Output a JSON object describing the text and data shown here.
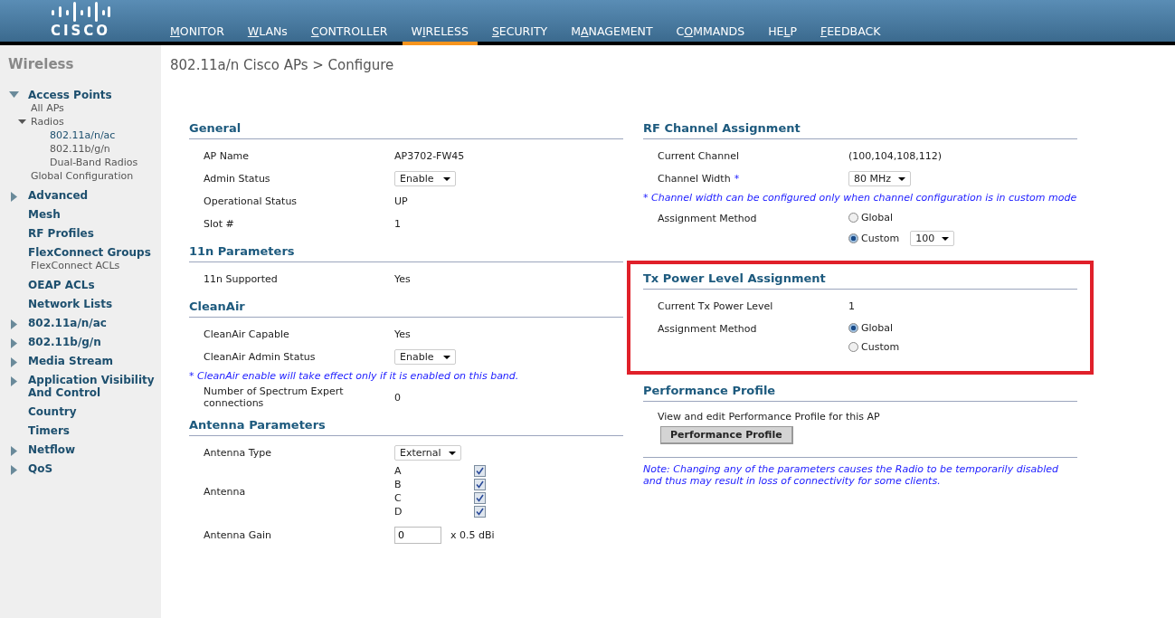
{
  "logo": {
    "text": "CISCO"
  },
  "nav": [
    {
      "key": "M",
      "after": "ONITOR",
      "selected": false
    },
    {
      "key": "W",
      "after": "LANs",
      "selected": false
    },
    {
      "key": "C",
      "after": "ONTROLLER",
      "selected": false
    },
    {
      "before": "W",
      "key": "I",
      "after": "RELESS",
      "selected": true
    },
    {
      "key": "S",
      "after": "ECURITY",
      "selected": false
    },
    {
      "before": "M",
      "key": "A",
      "after": "NAGEMENT",
      "selected": false
    },
    {
      "before": "C",
      "key": "O",
      "after": "MMANDS",
      "selected": false
    },
    {
      "before": "HE",
      "key": "L",
      "after": "P",
      "selected": false
    },
    {
      "key": "F",
      "after": "EEDBACK",
      "selected": false
    }
  ],
  "sidebar": {
    "title": "Wireless",
    "items": [
      {
        "label": "Access Points",
        "expanded": true,
        "children": [
          {
            "label": "All APs",
            "selected": false
          },
          {
            "label": "Radios",
            "expanded": true,
            "selected": false,
            "children": [
              {
                "label": "802.11a/n/ac",
                "selected": true
              },
              {
                "label": "802.11b/g/n",
                "selected": false
              },
              {
                "label": "Dual-Band Radios",
                "selected": false
              }
            ]
          },
          {
            "label": "Global Configuration",
            "selected": false
          }
        ]
      },
      {
        "label": "Advanced",
        "expanded": false
      },
      {
        "label": "Mesh"
      },
      {
        "label": "RF Profiles"
      },
      {
        "label": "FlexConnect Groups",
        "children": [
          {
            "label": "FlexConnect ACLs",
            "selected": false
          }
        ]
      },
      {
        "label": "OEAP ACLs"
      },
      {
        "label": "Network Lists"
      },
      {
        "label": "802.11a/n/ac",
        "expanded": false
      },
      {
        "label": "802.11b/g/n",
        "expanded": false
      },
      {
        "label": "Media Stream",
        "expanded": false
      },
      {
        "label": "Application Visibility And Control",
        "expanded": false
      },
      {
        "label": "Country"
      },
      {
        "label": "Timers"
      },
      {
        "label": "Netflow",
        "expanded": false
      },
      {
        "label": "QoS",
        "expanded": false
      }
    ]
  },
  "page_title": "802.11a/n Cisco APs > Configure",
  "columns": [
    [
      {
        "title": "General",
        "rows": [
          {
            "kind": "text",
            "label": "AP Name",
            "value": "AP3702-FW45"
          },
          {
            "kind": "select",
            "label": "Admin Status",
            "value": "Enable"
          },
          {
            "kind": "text",
            "label": "Operational Status",
            "value": "UP"
          },
          {
            "kind": "text",
            "label": "Slot #",
            "value": "1"
          }
        ]
      },
      {
        "title": "11n Parameters",
        "rows": [
          {
            "kind": "text",
            "label": "11n Supported",
            "value": "Yes"
          }
        ]
      },
      {
        "title": "CleanAir",
        "rows": [
          {
            "kind": "text",
            "label": "CleanAir Capable",
            "value": "Yes"
          },
          {
            "kind": "select",
            "label": "CleanAir Admin Status",
            "value": "Enable"
          },
          {
            "kind": "note",
            "text": "* CleanAir enable will take effect only if it is enabled on this band."
          },
          {
            "kind": "text",
            "label": "Number of Spectrum Expert connections",
            "value": "0"
          }
        ]
      },
      {
        "title": "Antenna Parameters",
        "rows": [
          {
            "kind": "select",
            "label": "Antenna Type",
            "value": "External"
          },
          {
            "kind": "checkboxes",
            "label": "Antenna",
            "options": [
              {
                "label": "A",
                "checked": true
              },
              {
                "label": "B",
                "checked": true
              },
              {
                "label": "C",
                "checked": true
              },
              {
                "label": "D",
                "checked": true
              }
            ]
          },
          {
            "kind": "input",
            "label": "Antenna Gain",
            "value": "0",
            "unit": "x 0.5 dBi"
          }
        ]
      }
    ],
    [
      {
        "title": "RF Channel Assignment",
        "rows": [
          {
            "kind": "text",
            "label": "Current Channel",
            "value": "(100,104,108,112)"
          },
          {
            "kind": "select",
            "label": "Channel Width",
            "marker": "*",
            "value": "80 MHz"
          },
          {
            "kind": "note",
            "text": "* Channel width can be configured only when channel configuration is in custom mode"
          },
          {
            "kind": "radio",
            "label": "Assignment Method",
            "options": [
              {
                "label": "Global",
                "selected": false
              },
              {
                "label": "Custom",
                "selected": true,
                "select": "100"
              }
            ]
          }
        ]
      },
      {
        "title": "Tx Power Level Assignment",
        "highlighted": true,
        "rows": [
          {
            "kind": "text",
            "label": "Current Tx Power Level",
            "value": "1"
          },
          {
            "kind": "radio",
            "label": "Assignment Method",
            "options": [
              {
                "label": "Global",
                "selected": true
              },
              {
                "label": "Custom",
                "selected": false
              }
            ]
          }
        ]
      },
      {
        "title": "Performance Profile",
        "rows": [
          {
            "kind": "plain",
            "text": "View and edit Performance Profile for this AP"
          },
          {
            "kind": "button",
            "label": "Performance Profile"
          },
          {
            "kind": "footnote",
            "text": "Note: Changing any of the parameters causes the Radio to be temporarily disabled and thus may result in loss of connectivity for some clients."
          }
        ]
      }
    ]
  ]
}
